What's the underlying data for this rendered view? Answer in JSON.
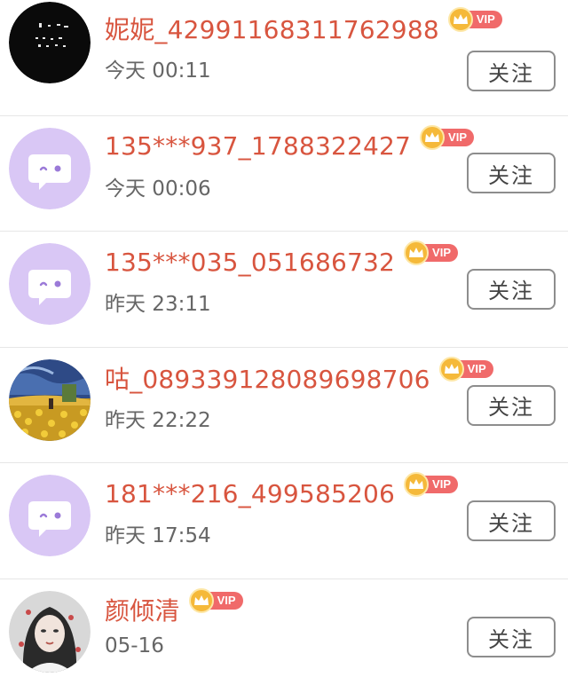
{
  "follow_label": "关注",
  "vip_label": "VIP",
  "colors": {
    "name": "#d8553f",
    "vip_tag": "#f06a6a",
    "crown": "#f5b93a",
    "default_avatar_bg": "#d9c7f5"
  },
  "users": [
    {
      "name": "妮妮_42991168311762988",
      "time": "今天 00:11",
      "avatar": "black-calligraphy-avatar"
    },
    {
      "name": "135***937_1788322427",
      "time": "今天 00:06",
      "avatar": "default-chat-bubble-avatar"
    },
    {
      "name": "135***035_051686732",
      "time": "昨天 23:11",
      "avatar": "default-chat-bubble-avatar"
    },
    {
      "name": "咕_08933912808969870​6",
      "time": "昨天 22:22",
      "avatar": "sunflower-painting-avatar"
    },
    {
      "name": "181***216_499585206",
      "time": "昨天 17:54",
      "avatar": "default-chat-bubble-avatar"
    },
    {
      "name": "颜倾清",
      "time": "05-16",
      "avatar": "portrait-photo-avatar"
    }
  ]
}
